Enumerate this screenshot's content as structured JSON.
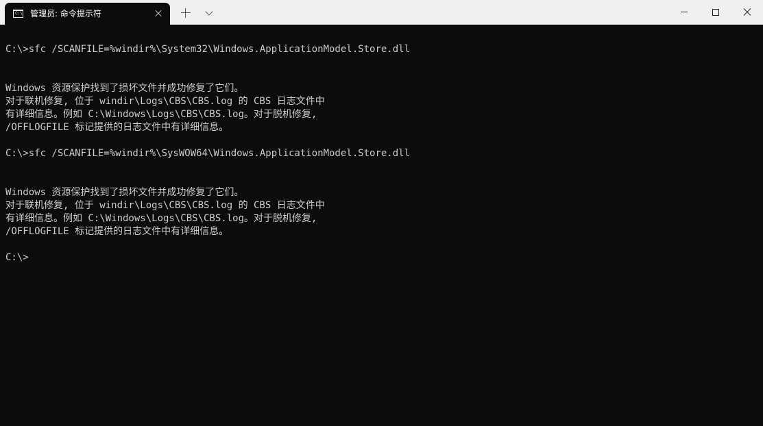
{
  "tab": {
    "title": "管理员: 命令提示符",
    "icon_text": "C:\\",
    "icon": "terminal-icon"
  },
  "colors": {
    "titlebar_bg": "#f0f0f0",
    "terminal_bg": "#0c0c0c",
    "terminal_text": "#cccccc"
  },
  "terminal": {
    "lines": [
      "C:\\>sfc /SCANFILE=%windir%\\System32\\Windows.ApplicationModel.Store.dll",
      "",
      "",
      "Windows 资源保护找到了损坏文件并成功修复了它们。",
      "对于联机修复, 位于 windir\\Logs\\CBS\\CBS.log 的 CBS 日志文件中",
      "有详细信息。例如 C:\\Windows\\Logs\\CBS\\CBS.log。对于脱机修复,",
      "/OFFLOGFILE 标记提供的日志文件中有详细信息。",
      "",
      "C:\\>sfc /SCANFILE=%windir%\\SysWOW64\\Windows.ApplicationModel.Store.dll",
      "",
      "",
      "Windows 资源保护找到了损坏文件并成功修复了它们。",
      "对于联机修复, 位于 windir\\Logs\\CBS\\CBS.log 的 CBS 日志文件中",
      "有详细信息。例如 C:\\Windows\\Logs\\CBS\\CBS.log。对于脱机修复,",
      "/OFFLOGFILE 标记提供的日志文件中有详细信息。",
      "",
      "C:\\>"
    ]
  }
}
